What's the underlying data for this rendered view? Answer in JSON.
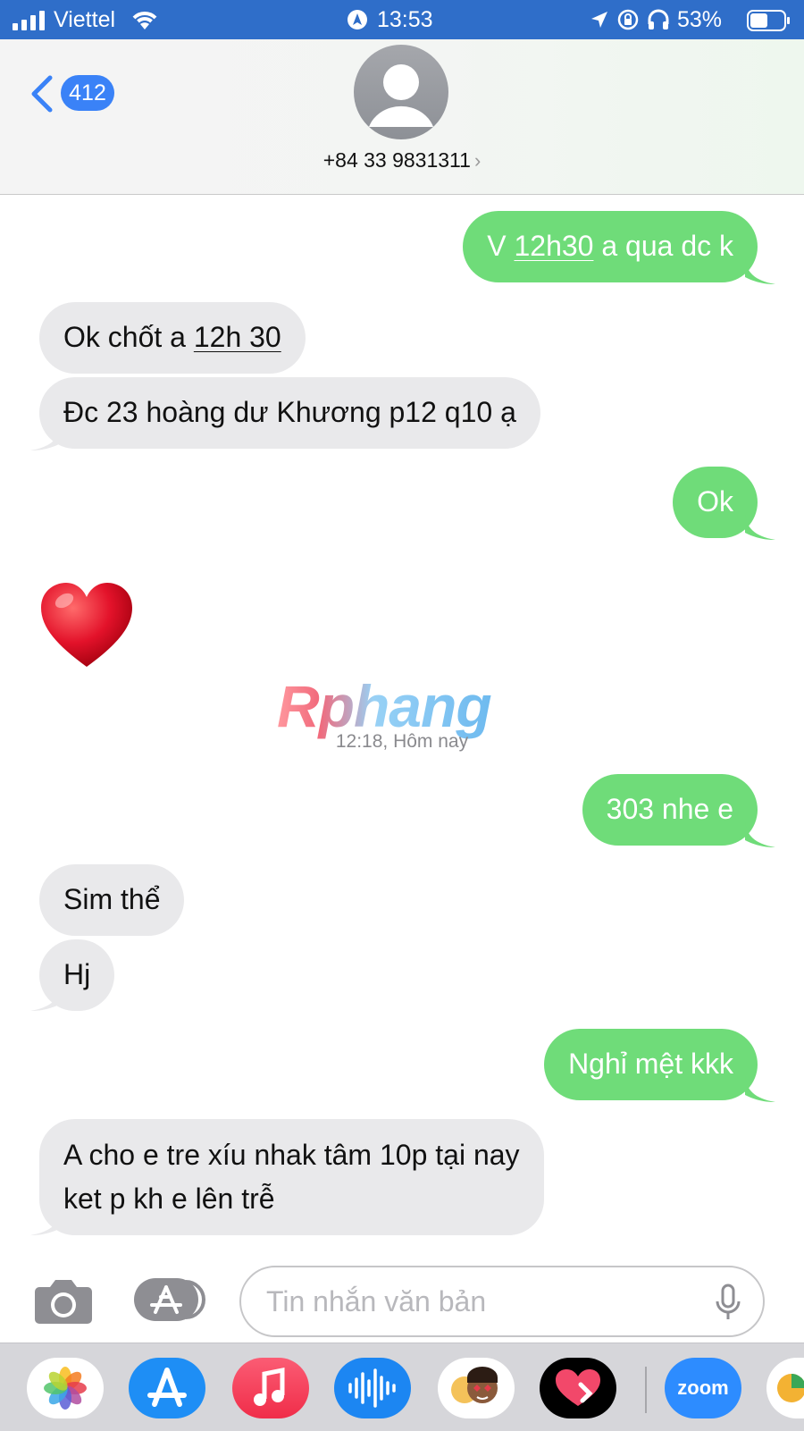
{
  "status_bar": {
    "carrier": "Viettel",
    "time": "13:53",
    "battery_percent": "53%",
    "battery_level": 0.53,
    "icons": [
      "signal-icon",
      "wifi-icon",
      "location-icon",
      "rotation-lock-icon",
      "headphones-icon",
      "battery-icon"
    ]
  },
  "header": {
    "back_icon": "chevron-left-icon",
    "unread_count": "412",
    "avatar_icon": "person-icon",
    "contact": "+84 33 9831311",
    "contact_chevron": "›"
  },
  "messages": [
    {
      "dir": "out",
      "parts": [
        "V ",
        "12h30",
        " a qua dc k"
      ]
    },
    {
      "dir": "in",
      "parts": [
        "Ok chốt a ",
        "12h 30"
      ]
    },
    {
      "dir": "in",
      "text": "Đc 23 hoàng dư Khương p12 q10 ạ"
    },
    {
      "dir": "out",
      "text": "Ok"
    },
    {
      "dir": "in",
      "emoji": "heart-emoji",
      "text": "❤️"
    },
    {
      "dir": "out",
      "text": "303 nhe e"
    },
    {
      "dir": "in",
      "text": "Sim thể"
    },
    {
      "dir": "in",
      "text": "Hj"
    },
    {
      "dir": "out",
      "text": "Nghỉ mệt kkk"
    },
    {
      "dir": "in",
      "lines": [
        "A cho e tre xíu nhak tâm 10p tại nay",
        "ket p kh e lên trễ"
      ]
    }
  ],
  "timestamp": "12:18, Hôm nay",
  "watermark": "Rphang",
  "composer": {
    "camera_icon": "camera-icon",
    "apps_icon": "app-store-icon",
    "placeholder": "Tin nhắn văn bản",
    "value": "",
    "mic_icon": "microphone-icon"
  },
  "app_drawer": [
    {
      "icon": "photos-icon",
      "color": "#ffffff"
    },
    {
      "icon": "app-store-icon",
      "color": "#1e8ef5"
    },
    {
      "icon": "music-icon",
      "color": "#f34860"
    },
    {
      "icon": "audio-waveform-icon",
      "color": "#1c86f2"
    },
    {
      "icon": "memoji-icon",
      "color": "#ffffff"
    },
    {
      "icon": "digital-touch-heart-icon",
      "color": "#000000"
    },
    {
      "icon": "zoom-icon",
      "label": "zoom",
      "color": "#2d8cff"
    },
    {
      "icon": "more-app-icon",
      "color": "#ffffff"
    }
  ],
  "colors": {
    "status_bar": "#2f6ec9",
    "outgoing_bubble": "#6fdc79",
    "incoming_bubble": "#e9e9eb",
    "badge": "#3a82f7"
  }
}
